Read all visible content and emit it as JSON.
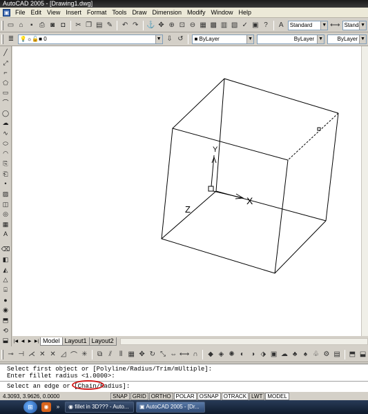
{
  "window": {
    "title": "AutoCAD 2005 - [Drawing1.dwg]"
  },
  "menu": [
    "File",
    "Edit",
    "View",
    "Insert",
    "Format",
    "Tools",
    "Draw",
    "Dimension",
    "Modify",
    "Window",
    "Help"
  ],
  "toolbar": {
    "text_style": "Standard",
    "dim_style": "Standard",
    "layer": "0",
    "color": "ByLayer",
    "linetype": "ByLayer",
    "lineweight": "ByLayer"
  },
  "tabs": [
    "Model",
    "Layout1",
    "Layout2"
  ],
  "active_tab": "Model",
  "ucs": {
    "x_label": "X",
    "y_label": "Y",
    "z_label": "Z"
  },
  "command": {
    "line1": "Select first object or [Polyline/Radius/Trim/mUltiple]:",
    "line2": "Enter fillet radius <1.0000>:",
    "prompt_prefix": "Select an edge or ",
    "prompt_option": "[Chain/",
    "prompt_suffix": "Radius]:"
  },
  "status": {
    "coords": "4.3093, 3.9626, 0.0000",
    "toggles": [
      "SNAP",
      "GRID",
      "ORTHO",
      "POLAR",
      "OSNAP",
      "OTRACK",
      "LWT",
      "MODEL"
    ],
    "on": [
      "POLAR",
      "OSNAP",
      "OTRACK",
      "MODEL"
    ]
  },
  "taskbar": {
    "more_label": "»",
    "items": [
      "fillet in 3D??? - Auto...",
      "AutoCAD 2005 - [Dr..."
    ],
    "active_index": 1
  }
}
